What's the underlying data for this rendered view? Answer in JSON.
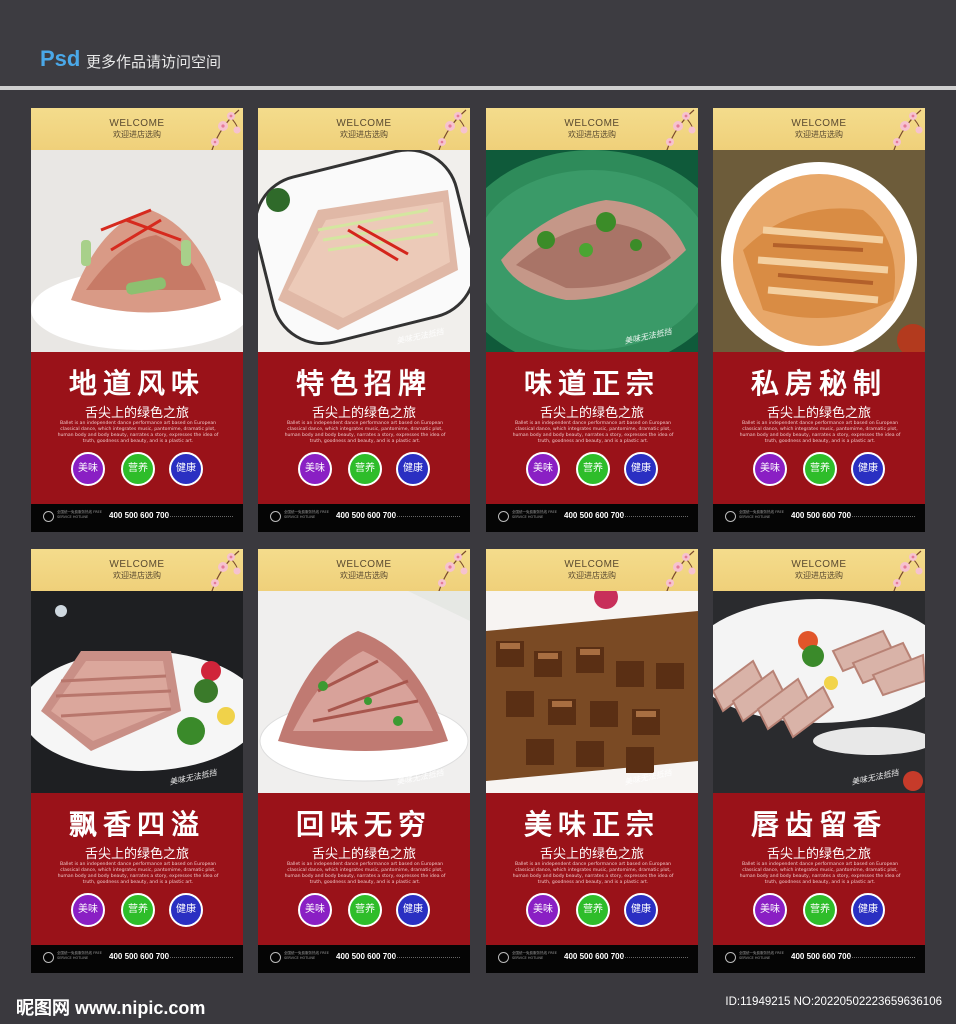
{
  "header": {
    "logo": "Psd",
    "text": "更多作品请访问空间"
  },
  "cards": [
    {
      "welcome": "WELCOME",
      "welcome_sub": "欢迎进店选购",
      "title": "地道风味",
      "subtitle": "舌尖上的绿色之旅",
      "seal": "美味无法抵挡",
      "badges": [
        "美味",
        "营养",
        "健康"
      ],
      "phone": "400 500 600 700"
    },
    {
      "welcome": "WELCOME",
      "welcome_sub": "欢迎进店选购",
      "title": "特色招牌",
      "subtitle": "舌尖上的绿色之旅",
      "seal": "美味无法抵挡",
      "badges": [
        "美味",
        "营养",
        "健康"
      ],
      "phone": "400 500 600 700"
    },
    {
      "welcome": "WELCOME",
      "welcome_sub": "欢迎进店选购",
      "title": "味道正宗",
      "subtitle": "舌尖上的绿色之旅",
      "seal": "美味无法抵挡",
      "badges": [
        "美味",
        "营养",
        "健康"
      ],
      "phone": "400 500 600 700"
    },
    {
      "welcome": "WELCOME",
      "welcome_sub": "欢迎进店选购",
      "title": "私房秘制",
      "subtitle": "舌尖上的绿色之旅",
      "seal": "",
      "badges": [
        "美味",
        "营养",
        "健康"
      ],
      "phone": "400 500 600 700"
    },
    {
      "welcome": "WELCOME",
      "welcome_sub": "欢迎进店选购",
      "title": "飘香四溢",
      "subtitle": "舌尖上的绿色之旅",
      "seal": "美味无法抵挡",
      "badges": [
        "美味",
        "营养",
        "健康"
      ],
      "phone": "400 500 600 700"
    },
    {
      "welcome": "WELCOME",
      "welcome_sub": "欢迎进店选购",
      "title": "回味无穷",
      "subtitle": "舌尖上的绿色之旅",
      "seal": "美味无法抵挡",
      "badges": [
        "美味",
        "营养",
        "健康"
      ],
      "phone": "400 500 600 700"
    },
    {
      "welcome": "WELCOME",
      "welcome_sub": "欢迎进店选购",
      "title": "美味正宗",
      "subtitle": "舌尖上的绿色之旅",
      "seal": "美味无法抵挡",
      "badges": [
        "美味",
        "营养",
        "健康"
      ],
      "phone": "400 500 600 700"
    },
    {
      "welcome": "WELCOME",
      "welcome_sub": "欢迎进店选购",
      "title": "唇齿留香",
      "subtitle": "舌尖上的绿色之旅",
      "seal": "美味无法抵挡",
      "badges": [
        "美味",
        "营养",
        "健康"
      ],
      "phone": "400 500 600 700"
    }
  ],
  "description": "Ballet is an independent dance performance art based on European classical dance, which integrates music, pantomime, dramatic plot, human body and body beauty, narrates a story, expresses the idea of truth, goodness and beauty, and is a plastic art.",
  "footer_small": "全国统一免费服务热线 FREE SERVICE HOTLINE",
  "watermark": {
    "left": "昵图网 www.nipic.com",
    "right": "ID:11949215 NO:20220502223659636106"
  },
  "colors": {
    "card_red": "#9a1219",
    "header_gold": "#efd07a",
    "badge_purple": "#8a1fc4",
    "badge_green": "#2ebd2a",
    "badge_blue": "#2a2fc2"
  }
}
